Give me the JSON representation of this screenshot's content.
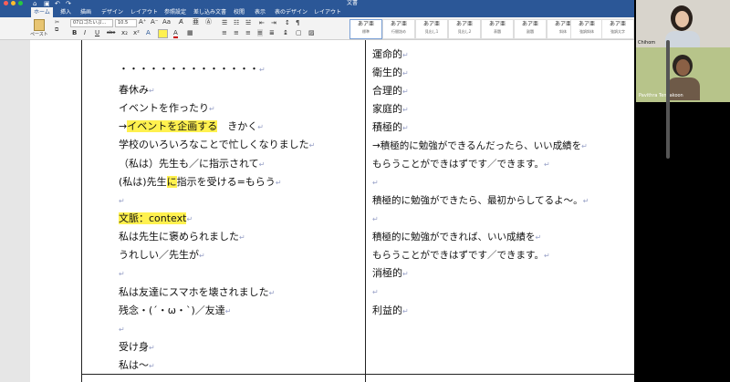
{
  "titlebar": {
    "doc_title": "文書"
  },
  "tabs": [
    "ホーム",
    "挿入",
    "描画",
    "デザイン",
    "レイアウト",
    "参照設定",
    "差し込み文書",
    "校閲",
    "表示",
    "表のデザイン",
    "レイアウト"
  ],
  "ribbon": {
    "paste_label": "ペースト",
    "font_name": "07ロゴたいぷ…",
    "font_size": "10.5",
    "format_buttons": [
      "B",
      "I",
      "U",
      "abe",
      "x₂",
      "x²"
    ],
    "styles": [
      {
        "big": "あア亜",
        "small": "標準"
      },
      {
        "big": "あア亜",
        "small": "行間詰め"
      },
      {
        "big": "あア亜",
        "small": "見出し1"
      },
      {
        "big": "あア亜",
        "small": "見出し2"
      },
      {
        "big": "あア亜",
        "small": "表題"
      },
      {
        "big": "あア亜",
        "small": "副題"
      },
      {
        "big": "あア亜",
        "small": "斜体"
      },
      {
        "big": "あア亜",
        "small": "強調斜体"
      },
      {
        "big": "あア亜",
        "small": "強調太字"
      }
    ]
  },
  "document": {
    "left_column": [
      "・・・・・・・・・・・・・・",
      "春休み",
      "イベントを作ったり",
      "→イベントを企画する　きかく",
      "学校のいろいろなことで忙しくなりました",
      "（私は）先生も／に指示されて",
      "(私は)先生に指示を受ける=もらう",
      "",
      "文脈：context",
      "私は先生に褒められました",
      "うれしい／先生が",
      "",
      "私は友達にスマホを壊されました",
      "残念・(´・ω・`)／友達",
      "",
      "受け身",
      "私は〜"
    ],
    "left_highlights": {
      "arrow": "→",
      "hl1": "イベントを企画する",
      "after1": "　きかく",
      "pre2": "(私は)先生",
      "hl2": "に",
      "after2": "指示を受ける=もらう",
      "hl3": "文脈：context"
    },
    "right_column": [
      "運命的",
      "衛生的",
      "合理的",
      "家庭的",
      "積極的",
      "→積極的に勉強ができるんだったら、いい成績を",
      "もらうことができはずです／できます。",
      "",
      "積極的に勉強ができたら、最初からしてるよ〜。",
      "",
      "積極的に勉強ができれば、いい成績を",
      "もらうことができはずです／できます。",
      "消極的",
      "",
      "利益的"
    ]
  },
  "participants": [
    {
      "name": "Chihom"
    },
    {
      "name": "Pavithra Tennakoon"
    }
  ],
  "colors": {
    "word_blue": "#2b5797",
    "highlight": "#fff14f"
  }
}
